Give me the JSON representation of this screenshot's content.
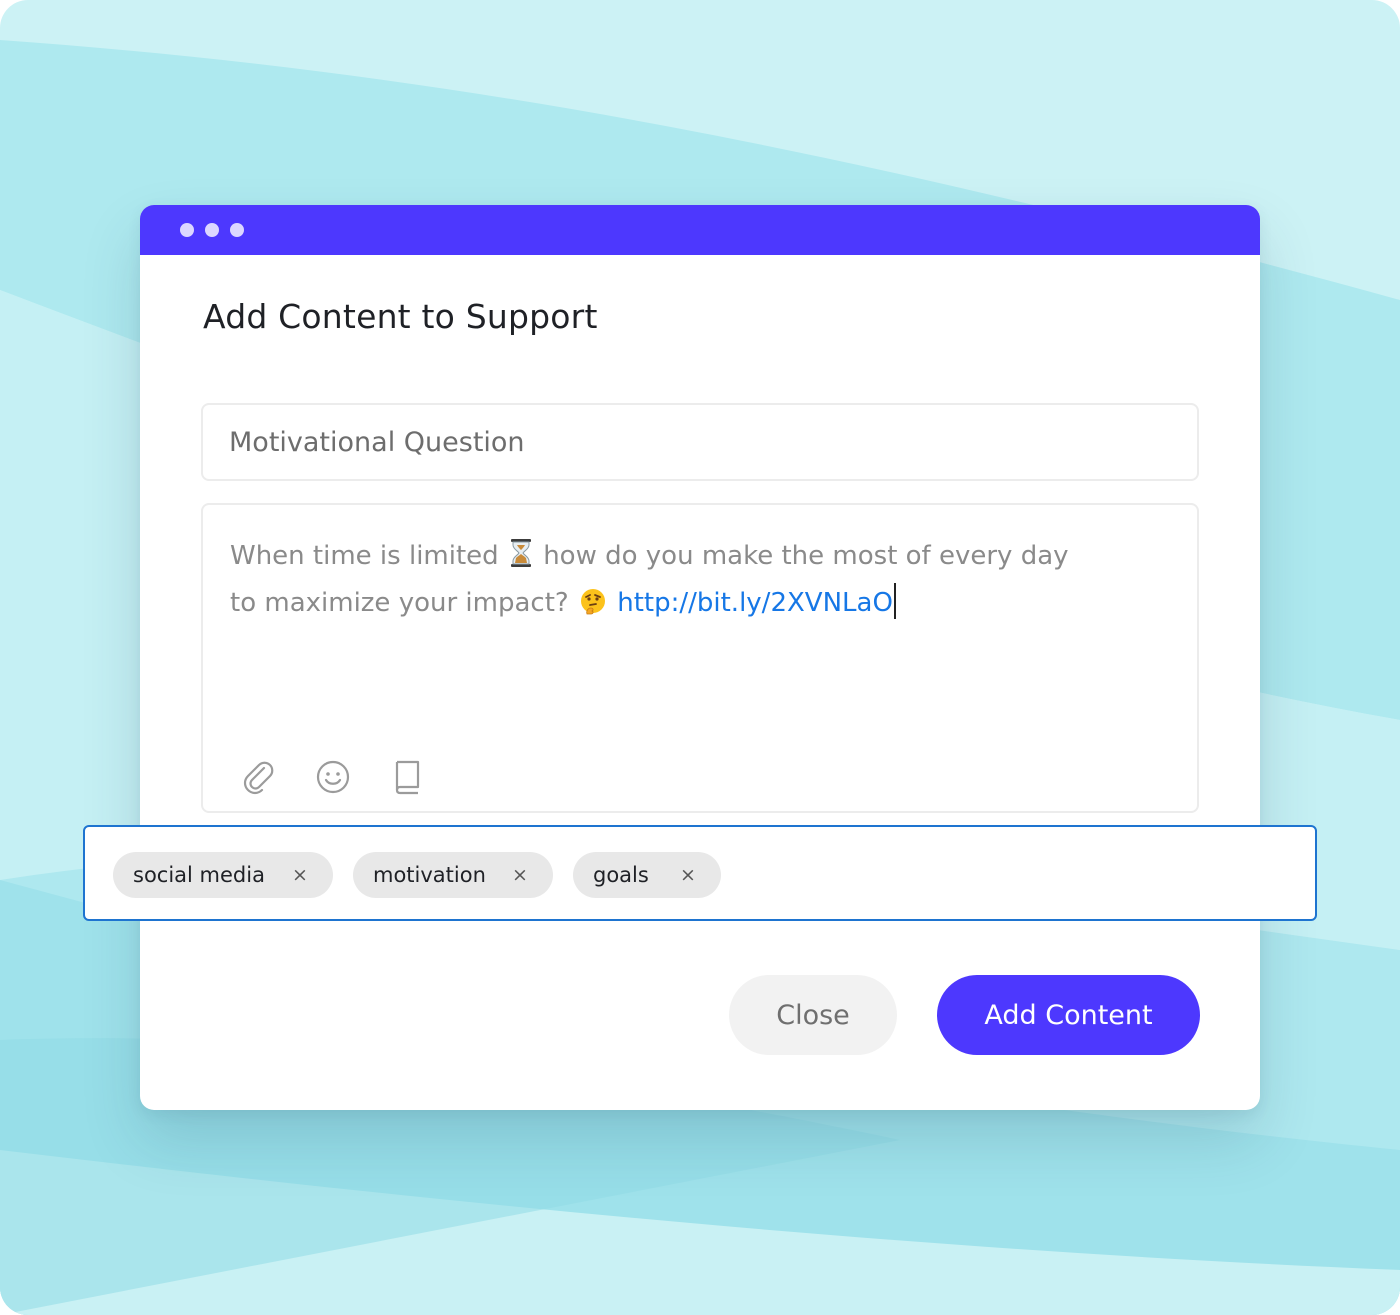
{
  "colors": {
    "accent": "#4d38fe",
    "link": "#1677e6",
    "tag_border": "#1e74d0",
    "button_text": "#ffffff"
  },
  "dialog": {
    "title": "Add Content to Support",
    "title_field": {
      "value": "",
      "placeholder": "Motivational Question"
    },
    "message": {
      "line1_before": "When time is limited",
      "emoji_hourglass": "⌛",
      "line1_after": "how do you make the most of every day",
      "line2_before": "to maximize your impact?",
      "emoji_thinking": "🤔",
      "link": "http://bit.ly/2XVNLaO"
    },
    "toolbar_icons": [
      "paperclip-icon",
      "smiley-icon",
      "book-icon"
    ],
    "tags": [
      {
        "label": "social media",
        "remove": "×"
      },
      {
        "label": "motivation",
        "remove": "×"
      },
      {
        "label": "goals",
        "remove": "×"
      }
    ],
    "buttons": {
      "close": "Close",
      "add": "Add Content"
    }
  }
}
